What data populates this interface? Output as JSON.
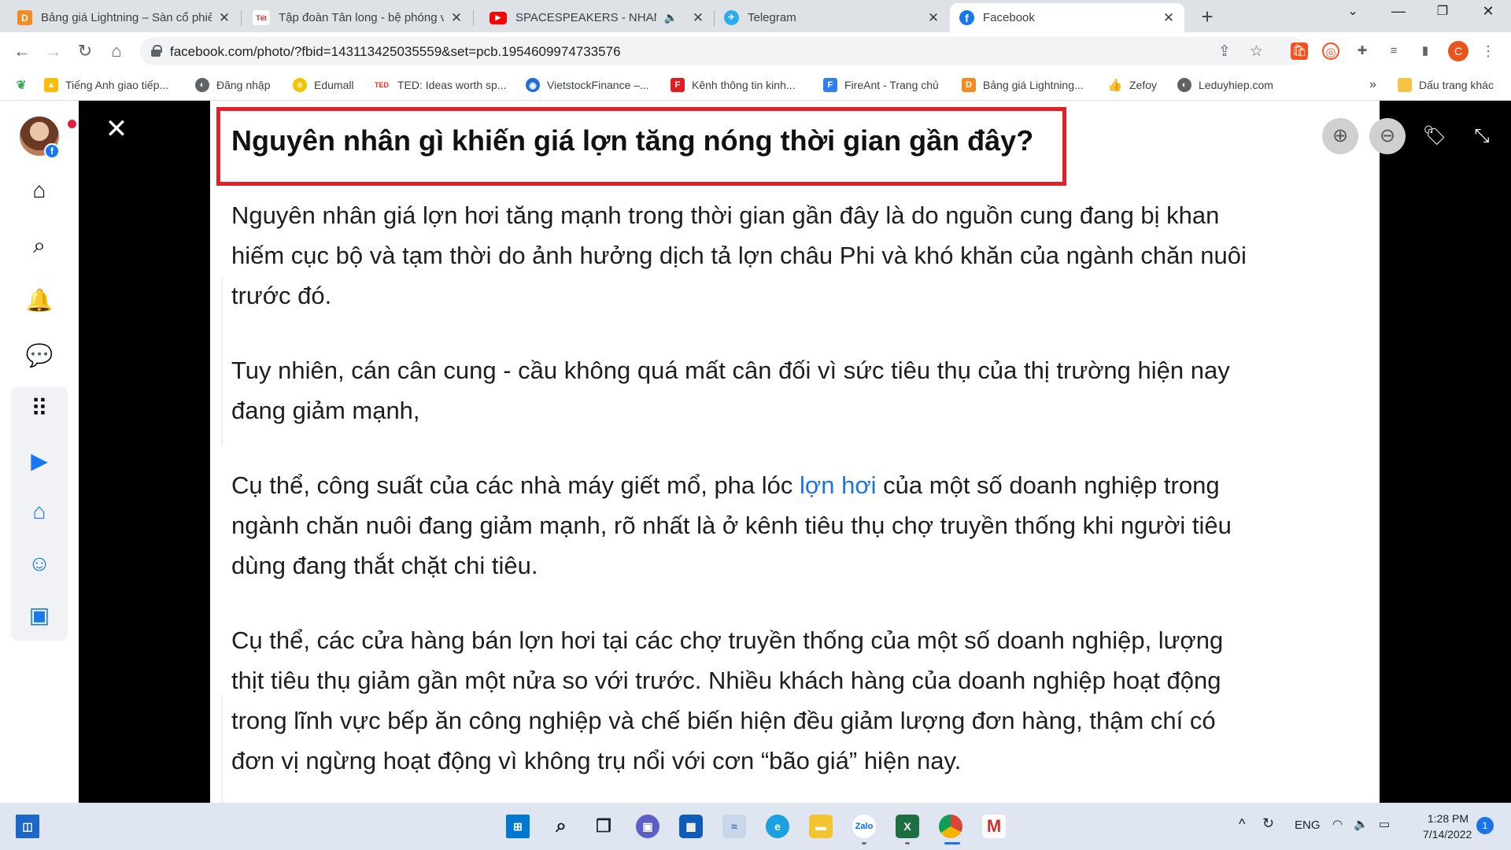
{
  "browser": {
    "tabs": [
      {
        "title": "Bảng giá Lightning – Sàn cổ phiế",
        "favicon": "D",
        "color": "#f28b22"
      },
      {
        "title": "Tập đoàn Tân long - bệ phóng vữ",
        "favicon": "Tết",
        "color": "#c62828"
      },
      {
        "title": "SPACESPEAKERS - NHANH L",
        "favicon": "▶",
        "color": "#ff0000"
      },
      {
        "title": "Telegram",
        "favicon": "✈",
        "color": "#2aabee"
      },
      {
        "title": "Facebook",
        "favicon": "f",
        "color": "#1877f2"
      }
    ],
    "new_tab": "+",
    "url": "facebook.com/photo/?fbid=143113425035559&set=pcb.1954609974733576",
    "profile_initial": "C",
    "bookmarks": [
      {
        "label": "Tiếng Anh giao tiếp...",
        "icon": "A",
        "color": "#34a853"
      },
      {
        "label": "Đăng nhập",
        "icon": "◐",
        "color": "#5f6368"
      },
      {
        "label": "Edumall",
        "icon": "e",
        "color": "#f5c400"
      },
      {
        "label": "TED: Ideas worth sp...",
        "icon": "TED",
        "color": "#e62b1e"
      },
      {
        "label": "VietstockFinance –...",
        "icon": "◉",
        "color": "#1e6fd9"
      },
      {
        "label": "Kênh thông tin kinh...",
        "icon": "F",
        "color": "#e31b23"
      },
      {
        "label": "FireAnt - Trang chủ",
        "icon": "F",
        "color": "#2f80ed"
      },
      {
        "label": "Bảng giá Lightning...",
        "icon": "D",
        "color": "#f28b22"
      },
      {
        "label": "Zefoy",
        "icon": "👍",
        "color": "#1a73e8"
      },
      {
        "label": "Leduyhiep.com",
        "icon": "◐",
        "color": "#5f6368"
      }
    ],
    "bookmarks_more": "»",
    "other_bookmarks": "Dấu trang khác"
  },
  "article": {
    "heading": "Nguyên nhân gì khiến giá lợn tăng nóng thời gian gần đây?",
    "p1_lines": [
      "Nguyên nhân giá lợn hơi tăng mạnh trong thời gian gần đây là do nguồn cung đang bị khan",
      "hiếm cục bộ và tạm thời do ảnh hưởng dịch tả lợn châu Phi và khó khăn của ngành chăn nuôi",
      "trước đó."
    ],
    "p2_lines": [
      "Tuy nhiên, cán cân cung - cầu không quá mất cân đối vì sức tiêu thụ của thị trường hiện nay",
      "đang giảm mạnh,"
    ],
    "p3": {
      "line1_before": "Cụ thể, công suất của các nhà máy giết mổ, pha lóc ",
      "line1_link": "lợn hơi",
      "line1_after": " của một số doanh nghiệp trong",
      "line2": "ngành chăn nuôi đang giảm mạnh, rõ nhất là ở kênh tiêu thụ chợ truyền thống khi người tiêu",
      "line3": "dùng đang thắt chặt chi tiêu."
    },
    "p4_lines": [
      "Cụ thể, các cửa hàng bán lợn hơi tại các chợ truyền thống của một số doanh nghiệp, lượng",
      "thịt tiêu thụ giảm gần một nửa so với trước. Nhiều khách hàng của doanh nghiệp hoạt động",
      "trong lĩnh vực bếp ăn công nghiệp và chế biến hiện đều giảm lượng đơn hàng, thậm chí có",
      "đơn vị ngừng hoạt động vì không trụ nổi với cơn “bão giá” hiện nay."
    ]
  },
  "taskbar": {
    "language": "ENG",
    "time": "1:28 PM",
    "date": "7/14/2022",
    "notification_count": "1"
  },
  "colors": {
    "highlight_box": "#e3202a",
    "link": "#1a73e8",
    "facebook": "#1877f2"
  }
}
